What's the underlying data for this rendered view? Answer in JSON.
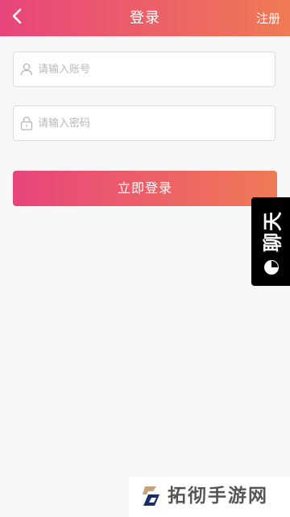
{
  "header": {
    "title": "登录",
    "register_label": "注册",
    "back_icon": "chevron-left-icon",
    "gradient_start": "#e8457c",
    "gradient_end": "#ef7a55"
  },
  "form": {
    "account": {
      "placeholder": "请输入账号",
      "value": "",
      "icon": "user-icon"
    },
    "password": {
      "placeholder": "请输入密码",
      "value": "",
      "icon": "lock-icon"
    },
    "login_label": "立即登录"
  },
  "chat_tab": {
    "label": "聊天",
    "icon": "chat-bubble-icon",
    "background": "#000000"
  },
  "watermark": {
    "text": "拓彻手游网"
  }
}
